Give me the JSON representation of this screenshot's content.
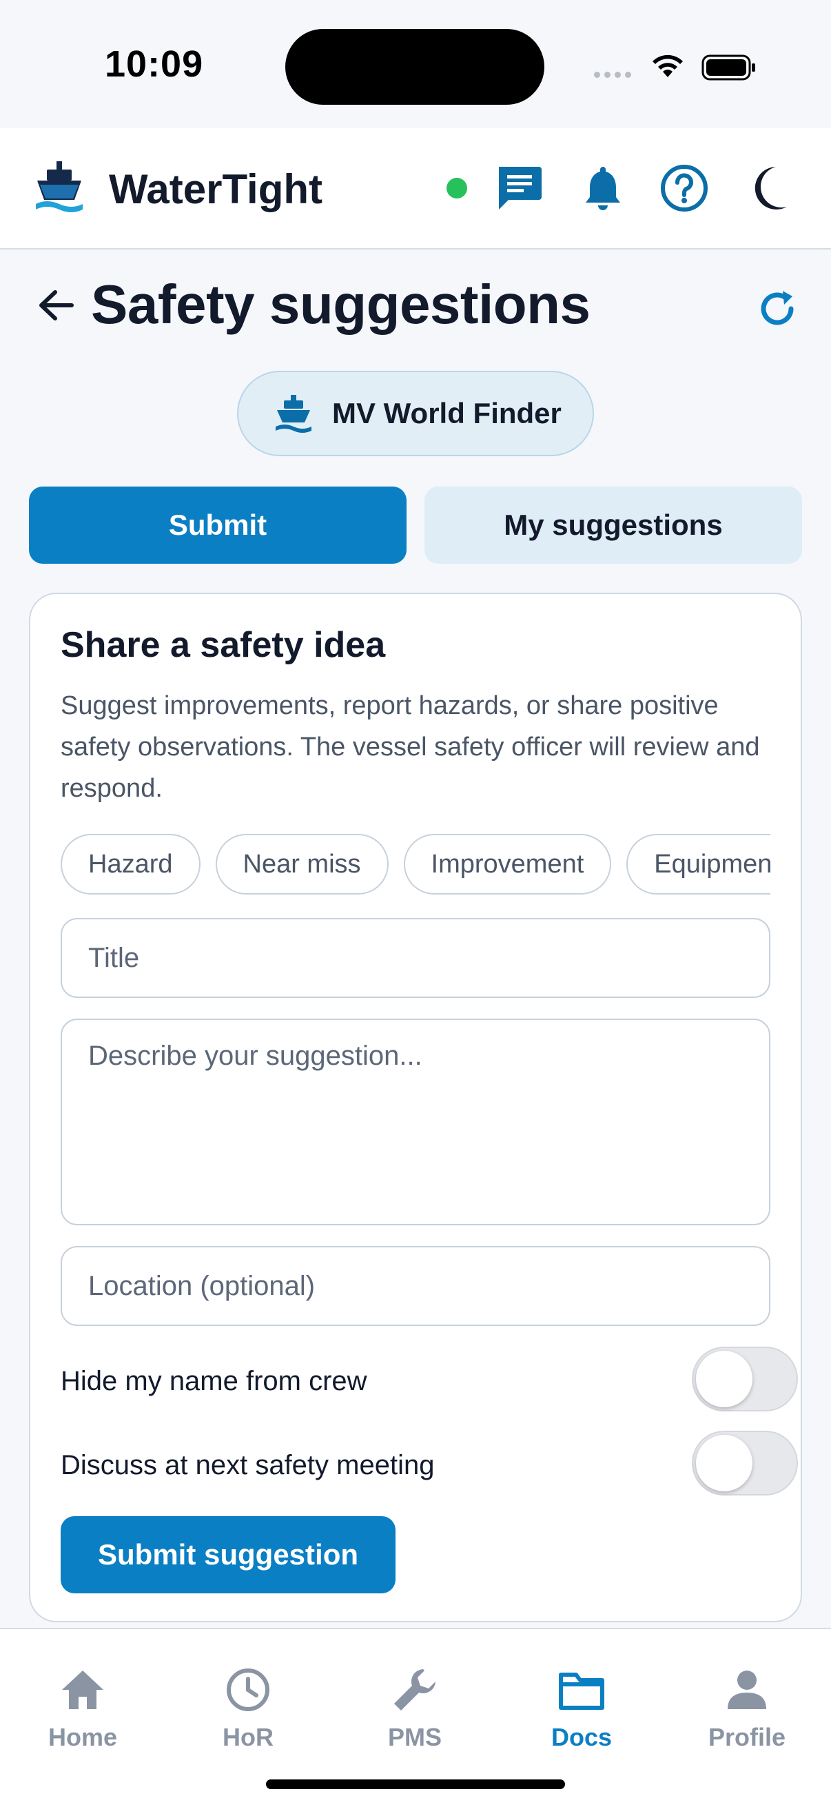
{
  "status_bar": {
    "time": "10:09"
  },
  "header": {
    "app_title": "WaterTight",
    "icons": [
      "ship-logo-icon",
      "online-status-dot",
      "chat-icon",
      "bell-icon",
      "help-icon",
      "dark-mode-moon-icon"
    ]
  },
  "page": {
    "title": "Safety suggestions",
    "back_icon": "arrow-left-icon",
    "refresh_icon": "refresh-icon"
  },
  "vessel": {
    "name": "MV World Finder",
    "icon": "ship-icon"
  },
  "tabs": [
    {
      "label": "Submit",
      "active": true
    },
    {
      "label": "My suggestions",
      "active": false
    }
  ],
  "card": {
    "title": "Share a safety idea",
    "description": "Suggest improvements, report hazards, or share positive safety observations. The vessel safety officer will review and respond.",
    "categories": [
      "Hazard",
      "Near miss",
      "Improvement",
      "Equipment"
    ],
    "fields": {
      "title_placeholder": "Title",
      "description_placeholder": "Describe your suggestion...",
      "location_placeholder": "Location (optional)"
    },
    "toggles": [
      {
        "label": "Hide my name from crew",
        "on": false
      },
      {
        "label": "Discuss at next safety meeting",
        "on": false
      }
    ],
    "submit_label": "Submit suggestion"
  },
  "bottom_nav": [
    {
      "label": "Home",
      "icon": "home-icon",
      "active": false
    },
    {
      "label": "HoR",
      "icon": "clock-icon",
      "active": false
    },
    {
      "label": "PMS",
      "icon": "wrench-icon",
      "active": false
    },
    {
      "label": "Docs",
      "icon": "folder-icon",
      "active": true
    },
    {
      "label": "Profile",
      "icon": "person-icon",
      "active": false
    }
  ],
  "colors": {
    "accent": "#0b7fc3",
    "text": "#121a2c",
    "muted": "#4a5566",
    "online": "#27c15b"
  }
}
